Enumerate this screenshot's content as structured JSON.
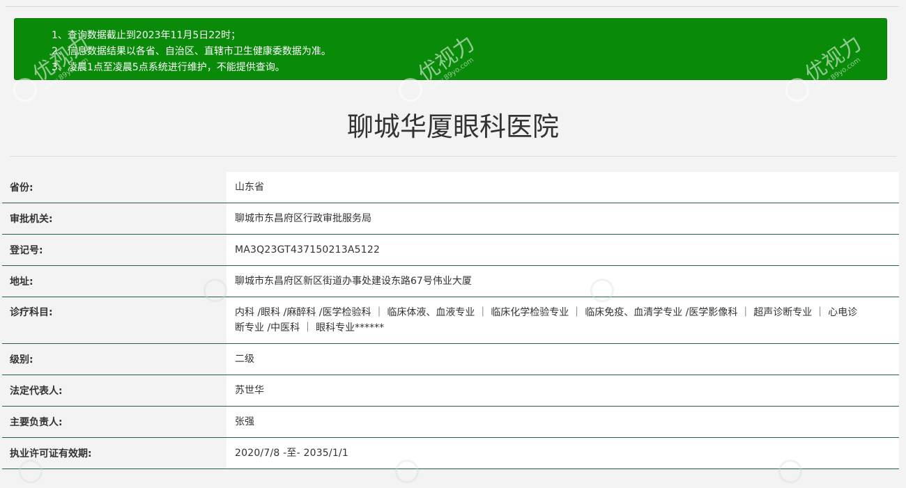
{
  "notice": {
    "lines": [
      "1、查询数据截止到2023年11月5日22时；",
      "2、信息数据结果以各省、自治区、直辖市卫生健康委数据为准。",
      "3、凌晨1点至凌晨5点系统进行维护，不能提供查询。"
    ]
  },
  "title": "聊城华厦眼科医院",
  "rows": [
    {
      "label": "省份:",
      "value": "山东省"
    },
    {
      "label": "审批机关:",
      "value": "聊城市东昌府区行政审批服务局"
    },
    {
      "label": "登记号:",
      "value": "MA3Q23GT437150213A5122"
    },
    {
      "label": "地址:",
      "value": "聊城市东昌府区新区街道办事处建设东路67号伟业大厦"
    },
    {
      "label": "诊疗科目:",
      "value": "内科 /眼科 /麻醉科 /医学检验科 ｜ 临床体液、血液专业 ｜ 临床化学检验专业 ｜ 临床免疫、血清学专业 /医学影像科 ｜ 超声诊断专业 ｜ 心电诊断专业 /中医科 ｜ 眼科专业******"
    },
    {
      "label": "级别:",
      "value": "二级"
    },
    {
      "label": "法定代表人:",
      "value": "苏世华"
    },
    {
      "label": "主要负责人:",
      "value": "张强"
    },
    {
      "label": "执业许可证有效期:",
      "value": "2020/7/8 -至- 2035/1/1"
    }
  ],
  "watermark": {
    "brand": "优视力",
    "url": "www.89yo.com"
  }
}
